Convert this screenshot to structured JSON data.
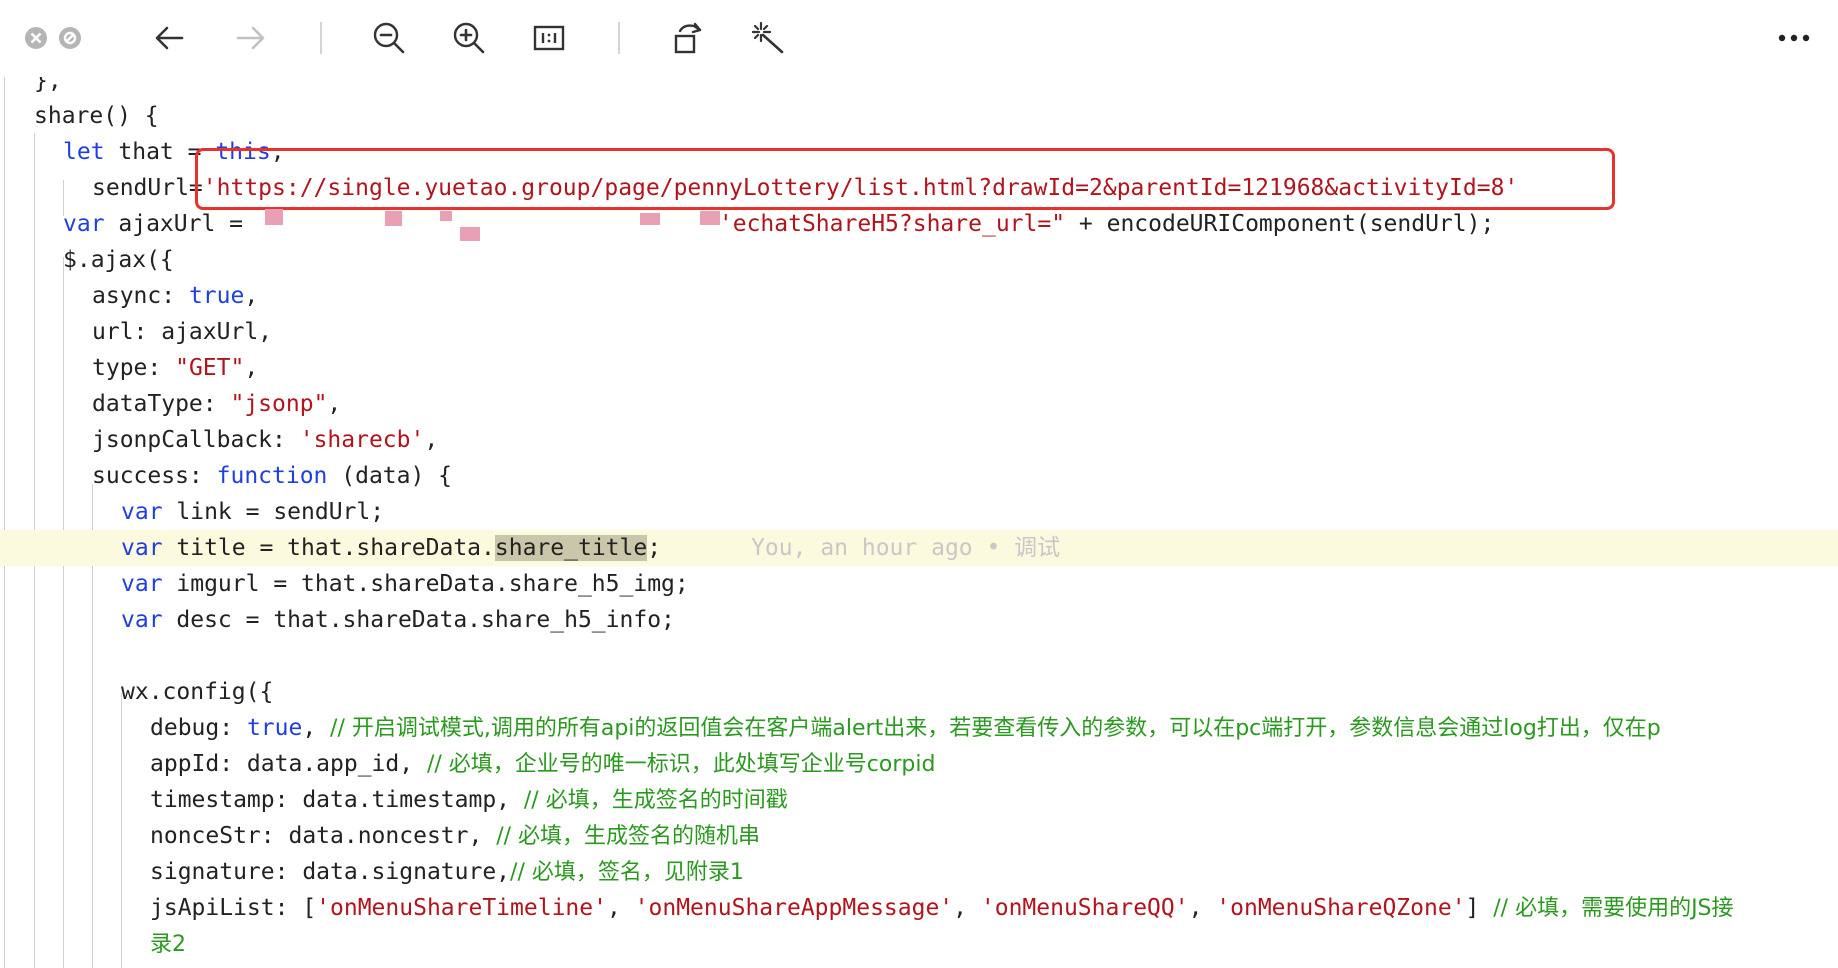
{
  "toolbar": {
    "icons": [
      "close-icon",
      "minimize-icon",
      "back-arrow-icon",
      "forward-arrow-icon",
      "zoom-out-icon",
      "zoom-in-icon",
      "actual-size-icon",
      "rotate-icon",
      "magic-wand-icon",
      "more-icon"
    ]
  },
  "code": {
    "line0": "},",
    "line1": "share() {",
    "line2_kw": "let",
    "line2_rest": " that = ",
    "line2_this": "this",
    "line2_end": ",",
    "line3_var": "sendUrl=",
    "line3_url": "'https://single.yuetao.group/page/pennyLottery/list.html?drawId=2&parentId=121968&activityId=8'",
    "line4_kw": "var",
    "line4_rest": " ajaxUrl = ",
    "line4_str": "'echatShareH5?share_url=\"",
    "line4_end": " + encodeURIComponent(sendUrl);",
    "line5": "$.ajax({",
    "line6_a": "async: ",
    "line6_b": "true",
    "line6_c": ",",
    "line7": "url: ajaxUrl,",
    "line8_a": "type: ",
    "line8_b": "\"GET\"",
    "line8_c": ",",
    "line9_a": "dataType: ",
    "line9_b": "\"jsonp\"",
    "line9_c": ",",
    "line10_a": "jsonpCallback: ",
    "line10_b": "'sharecb'",
    "line10_c": ",",
    "line11_a": "success: ",
    "line11_b": "function",
    "line11_c": " (data) {",
    "line12_kw": "var",
    "line12_rest": " link = sendUrl;",
    "line13_kw": "var",
    "line13_rest": " title = that.shareData.",
    "line13_hl": "share_title",
    "line13_end": ";",
    "line13_blame": "You, an hour ago • 调试",
    "line14_kw": "var",
    "line14_rest": " imgurl = that.shareData.share_h5_img;",
    "line15_kw": "var",
    "line15_rest": " desc = that.shareData.share_h5_info;",
    "line17": "wx.config({",
    "line18_a": "debug: ",
    "line18_b": "true",
    "line18_c": ", ",
    "line18_cm": "// 开启调试模式,调用的所有api的返回值会在客户端alert出来，若要查看传入的参数，可以在pc端打开，参数信息会通过log打出，仅在p",
    "line19_a": "appId: data.app_id, ",
    "line19_cm": "// 必填，企业号的唯一标识，此处填写企业号corpid",
    "line20_a": "timestamp: data.timestamp, ",
    "line20_cm": "// 必填，生成签名的时间戳",
    "line21_a": "nonceStr: data.noncestr, ",
    "line21_cm": "// 必填，生成签名的随机串",
    "line22_a": "signature: data.signature,",
    "line22_cm": "// 必填，签名，见附录1",
    "line23_a": "jsApiList: [",
    "line23_s1": "'onMenuShareTimeline'",
    "line23_s2": "'onMenuShareAppMessage'",
    "line23_s3": "'onMenuShareQQ'",
    "line23_s4": "'onMenuShareQZone'",
    "line23_sep": ", ",
    "line23_end": "] ",
    "line23_cm": "// 必填，需要使用的JS接",
    "line24_cm": "录2"
  },
  "colors": {
    "keyword": "#1f3fe0",
    "string": "#b3141c",
    "comment": "#2a9a1f",
    "highlight_box": "#e8322b"
  }
}
